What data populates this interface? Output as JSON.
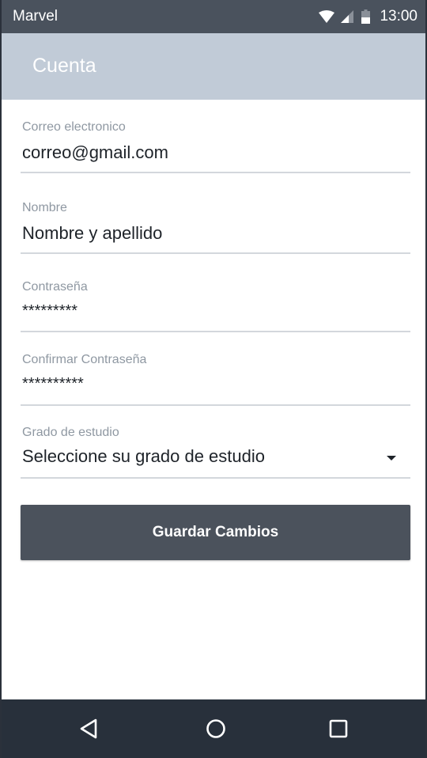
{
  "status_bar": {
    "carrier": "Marvel",
    "time": "13:00",
    "icons": [
      "wifi-icon",
      "signal-icon",
      "battery-icon"
    ]
  },
  "app_bar": {
    "title": "Cuenta",
    "background": "#c1cbd7"
  },
  "form": {
    "email": {
      "label": "Correo electronico",
      "value": "correo@gmail.com"
    },
    "name": {
      "label": "Nombre",
      "value": "Nombre y apellido"
    },
    "password": {
      "label": "Contraseña",
      "value": "*********"
    },
    "confirm_password": {
      "label": "Confirmar  Contraseña",
      "value": "**********"
    },
    "education": {
      "label": "Grado de estudio",
      "value": "Seleccione su grado de estudio"
    }
  },
  "save_button": {
    "label": "Guardar Cambios",
    "background": "#4b525c"
  },
  "nav_bar": {
    "buttons": [
      "back-icon",
      "home-icon",
      "recents-icon"
    ],
    "background": "#28303b"
  }
}
